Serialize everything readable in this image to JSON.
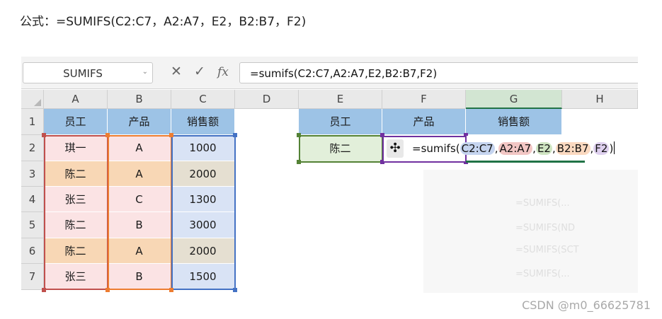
{
  "caption": "公式：=SUMIFS(C2:C7，A2:A7，E2，B2:B7，F2)",
  "name_box": {
    "value": "SUMIFS",
    "arrow": "⌄"
  },
  "formula_bar": {
    "cancel_icon": "✕",
    "enter_icon": "✓",
    "fx_label": "fx",
    "formula": "=sumifs(C2:C7,A2:A7,E2,B2:B7,F2)"
  },
  "columns": [
    "A",
    "B",
    "C",
    "D",
    "E",
    "F",
    "G",
    "H"
  ],
  "rows": [
    "1",
    "2",
    "3",
    "4",
    "5",
    "6",
    "7"
  ],
  "table_left": {
    "headers": [
      "员工",
      "产品",
      "销售额"
    ],
    "rows": [
      [
        "琪一",
        "A",
        "1000"
      ],
      [
        "陈二",
        "A",
        "2000"
      ],
      [
        "张三",
        "C",
        "1300"
      ],
      [
        "陈二",
        "B",
        "3000"
      ],
      [
        "陈二",
        "A",
        "2000"
      ],
      [
        "张三",
        "B",
        "1500"
      ]
    ]
  },
  "table_right": {
    "headers": [
      "员工",
      "产品",
      "销售额"
    ],
    "e2": "陈二"
  },
  "cell_editor": {
    "prefix": "=sumifs(",
    "tokens": [
      "C2:C7",
      ",",
      "A2:A7",
      ",",
      "E2",
      ",",
      "B2:B7",
      ",",
      "F2",
      ")"
    ]
  },
  "range_colors": {
    "C2:C7": "#4472c4",
    "A2:A7": "#c0504d",
    "E2": "#548235",
    "B2:B7": "#ed7d31",
    "F2": "#7030a0",
    "G": "#217346"
  },
  "ghost_text": [
    "=SUMIFS(...",
    "=SUMIFS(ND",
    "=SUMIFS(SCT",
    "=SUMIFS(..."
  ],
  "watermark": "CSDN @m0_66625781"
}
